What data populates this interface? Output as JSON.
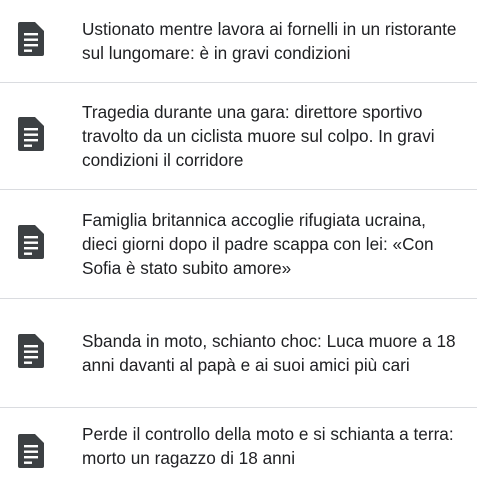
{
  "news_list": {
    "items": [
      {
        "title": "Ustionato mentre lavora ai fornelli in un ristorante sul lungomare: è in gravi condizioni",
        "icon": "document-icon"
      },
      {
        "title": "Tragedia durante una gara: direttore sportivo travolto da un ciclista muore sul colpo. In gravi condizioni il corridore",
        "icon": "document-icon"
      },
      {
        "title": "Famiglia britannica accoglie rifugiata ucraina, dieci giorni dopo il padre scappa con lei: «Con Sofia è stato subito amore»",
        "icon": "document-icon"
      },
      {
        "title": "Sbanda in moto, schianto choc: Luca muore a 18 anni davanti al papà e ai suoi amici più cari",
        "icon": "document-icon"
      },
      {
        "title": "Perde il controllo della moto e si schianta a terra: morto un ragazzo di 18 anni",
        "icon": "document-icon"
      }
    ]
  },
  "colors": {
    "icon": "#3c4043",
    "text": "#202124",
    "divider": "#dadce0"
  }
}
